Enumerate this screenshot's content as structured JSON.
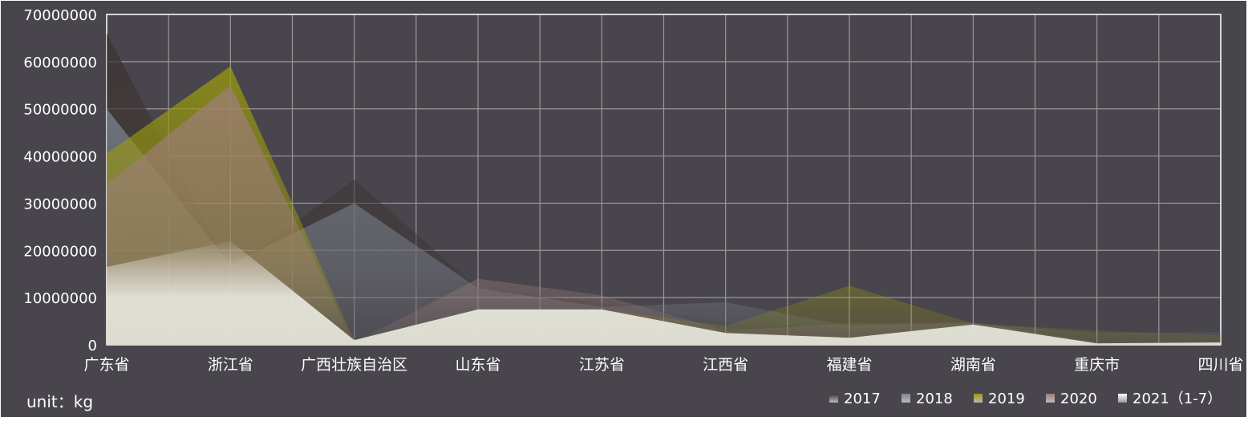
{
  "chart_data": {
    "type": "area",
    "categories": [
      "广东省",
      "浙江省",
      "广西壮族自治区",
      "山东省",
      "江苏省",
      "江西省",
      "福建省",
      "湖南省",
      "重庆市",
      "四川省"
    ],
    "y_ticks": [
      "0",
      "10000000",
      "20000000",
      "30000000",
      "40000000",
      "50000000",
      "60000000",
      "70000000"
    ],
    "ylim": [
      0,
      70000000
    ],
    "unit_label": "unit：kg",
    "grid": true,
    "legend_position": "bottom-right",
    "series": [
      {
        "name": "2017",
        "color": "#3b3330",
        "values": [
          66000000,
          16000000,
          35000000,
          12000000,
          9000000,
          5000000,
          3500000,
          4500000,
          2000000,
          2300000
        ]
      },
      {
        "name": "2018",
        "color": "#7d8491",
        "values": [
          50000000,
          17000000,
          30000000,
          12000000,
          8000000,
          9000000,
          4000000,
          4500000,
          2500000,
          2700000
        ]
      },
      {
        "name": "2019",
        "color": "#9a9a0d",
        "values": [
          40500000,
          59000000,
          1000000,
          7500000,
          7500000,
          4000000,
          12500000,
          4500000,
          3000000,
          2000000
        ]
      },
      {
        "name": "2020",
        "color": "#9e7d78",
        "values": [
          34000000,
          55000000,
          500000,
          14000000,
          10500000,
          3000000,
          4500000,
          4800000,
          500000,
          700000
        ]
      },
      {
        "name": "2021（1-7）",
        "color": "#dcdccf",
        "values": [
          16500000,
          22000000,
          1000000,
          7500000,
          7500000,
          2500000,
          1500000,
          4300000,
          300000,
          500000
        ]
      }
    ]
  }
}
